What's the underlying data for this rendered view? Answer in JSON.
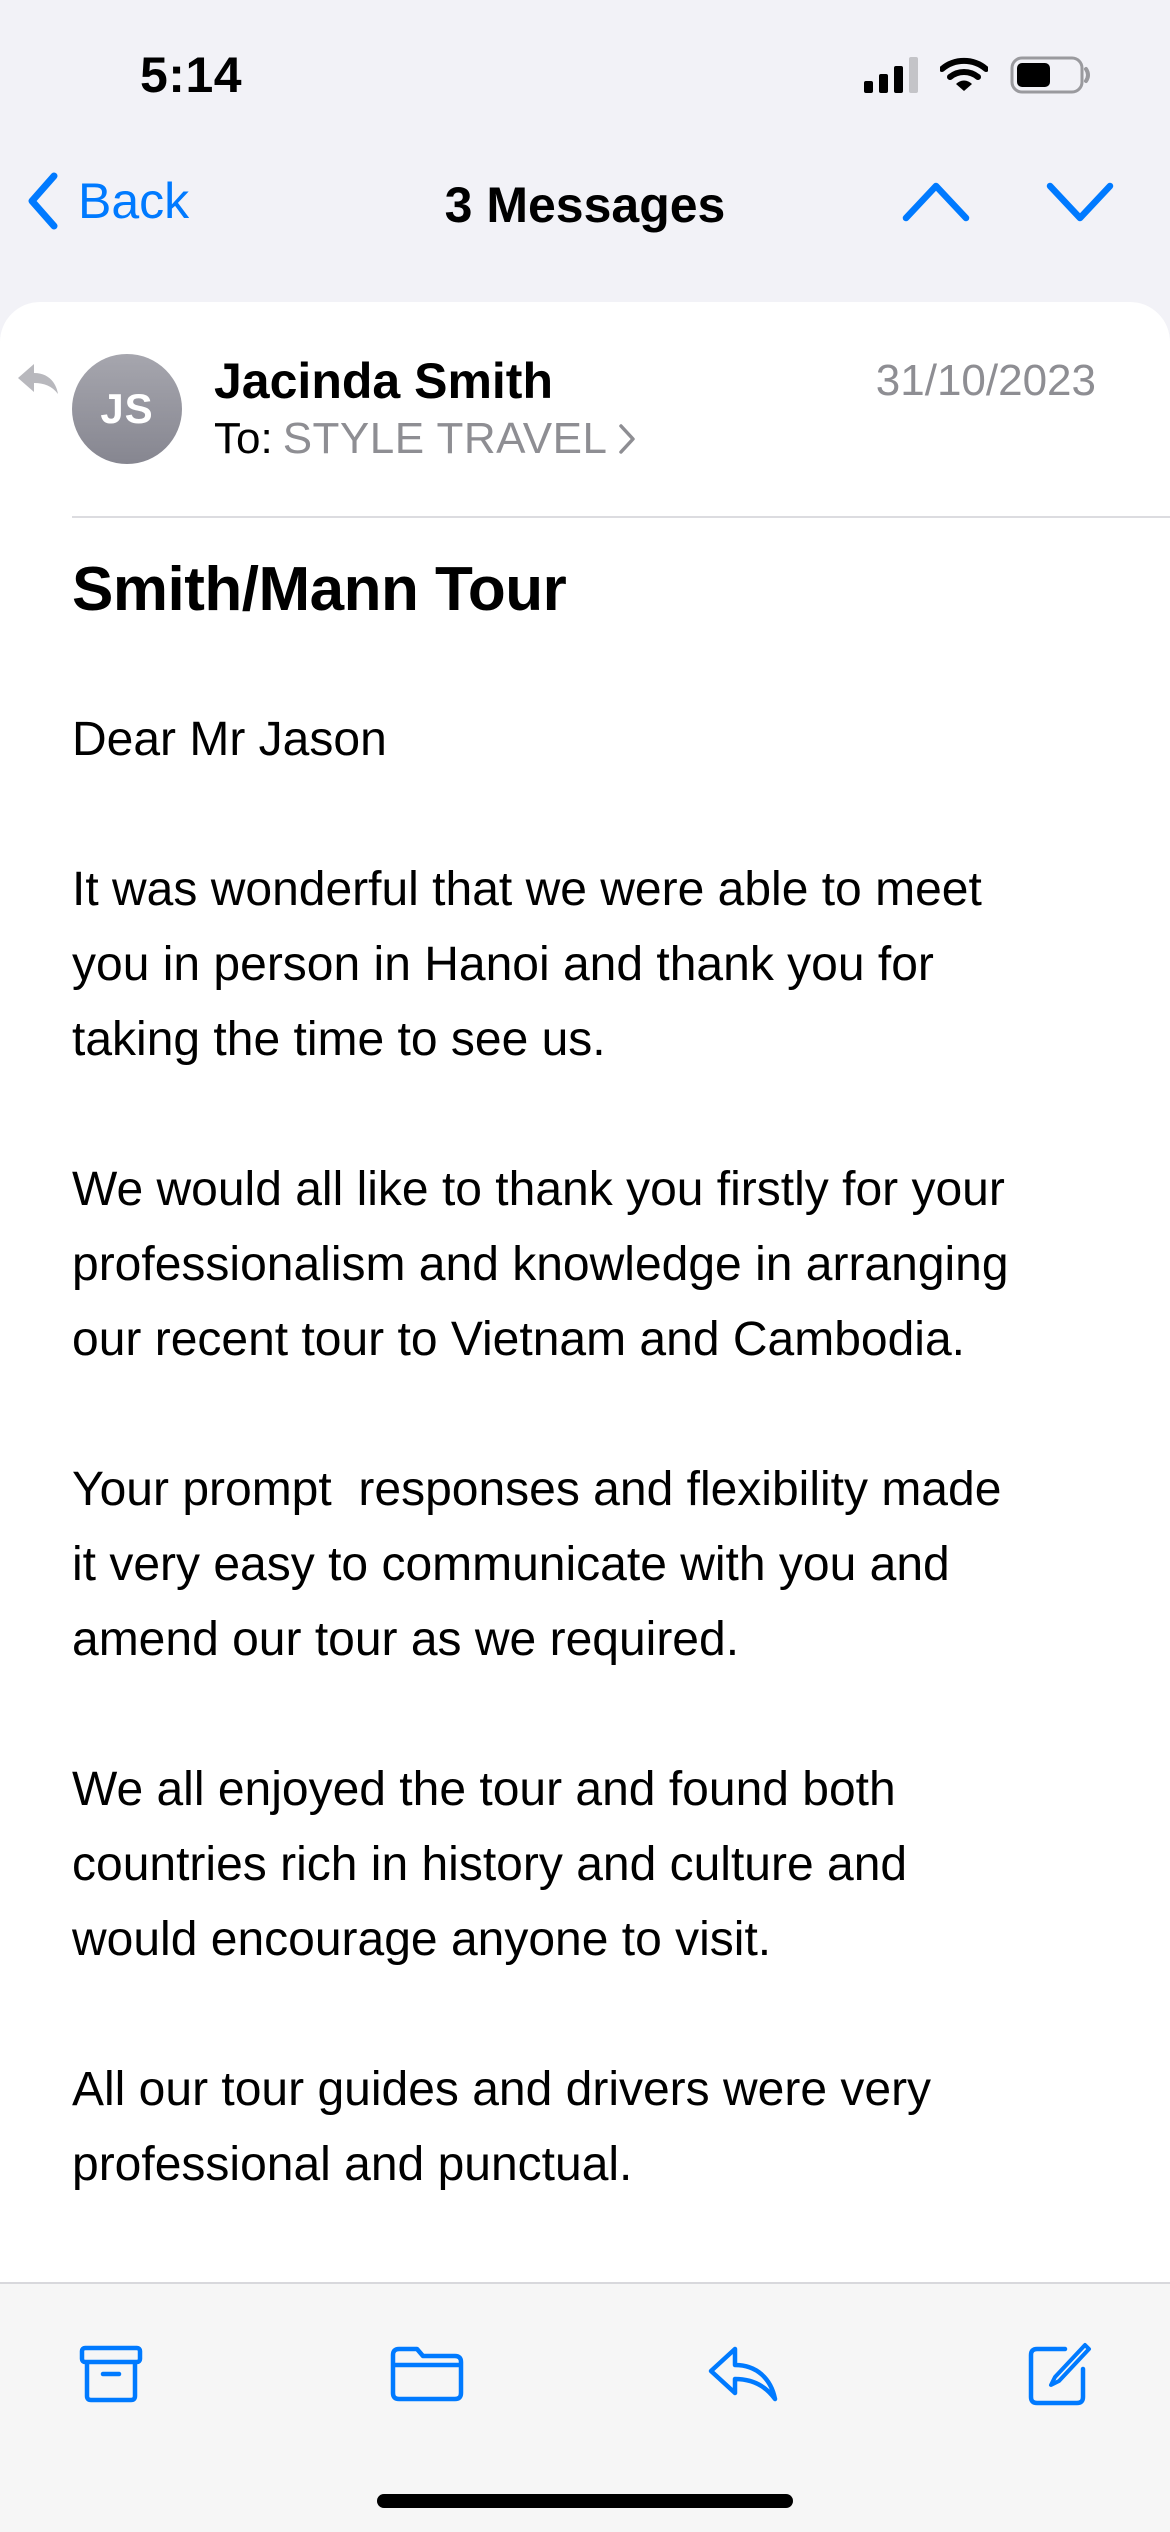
{
  "status_bar": {
    "time": "5:14",
    "battery_level": 0.55
  },
  "nav": {
    "back_label": "Back",
    "title": "3 Messages"
  },
  "message": {
    "avatar_initials": "JS",
    "sender": "Jacinda Smith",
    "date": "31/10/2023",
    "to_label": "To:",
    "recipient": "STYLE TRAVEL",
    "subject": "Smith/Mann Tour",
    "paragraphs": [
      "Dear Mr Jason",
      "It was wonderful that we were able to meet\nyou in person in Hanoi and thank you for\ntaking the time to see us.",
      "We would all like to thank you firstly for your\nprofessionalism and knowledge in arranging\nour recent tour to Vietnam and Cambodia.",
      "Your prompt  responses and flexibility made\nit very easy to communicate with you and\namend our tour as we required.",
      "We all enjoyed the tour and found both\ncountries rich in history and culture and\nwould encourage anyone to visit.",
      "All our tour guides and drivers were very\nprofessional and punctual."
    ]
  },
  "toolbar": {
    "icons": [
      "archive-icon",
      "folder-icon",
      "reply-icon",
      "compose-icon"
    ]
  },
  "colors": {
    "accent": "#007aff",
    "secondary_text": "#8e8e93",
    "avatar": "#9a9aa2"
  }
}
